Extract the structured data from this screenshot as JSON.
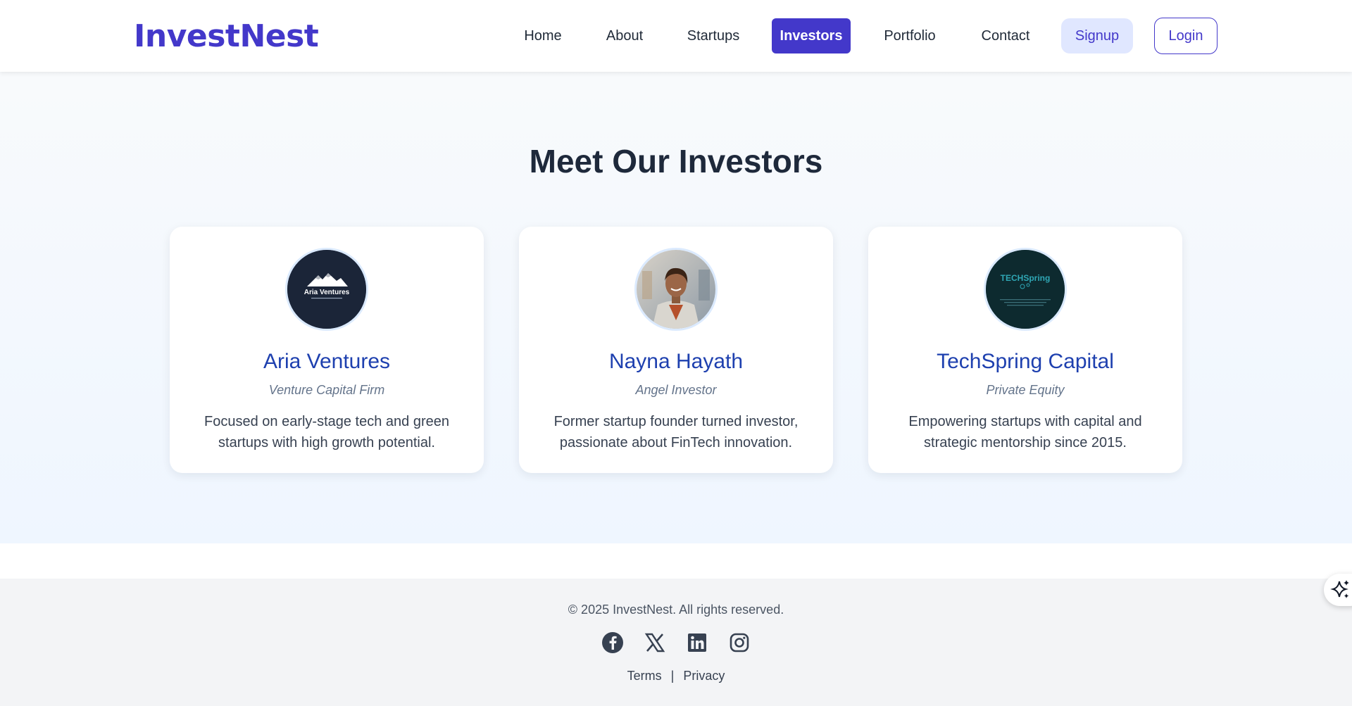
{
  "header": {
    "logo": "InvestNest",
    "nav": [
      "Home",
      "About",
      "Startups",
      "Investors",
      "Portfolio",
      "Contact"
    ],
    "active_nav": "Investors",
    "signup": "Signup",
    "login": "Login"
  },
  "main": {
    "title": "Meet Our Investors",
    "investors": [
      {
        "name": "Aria Ventures",
        "role": "Venture Capital Firm",
        "description": "Focused on early-stage tech and green startups with high growth potential.",
        "logo_text": "Aria Ventures"
      },
      {
        "name": "Nayna Hayath",
        "role": "Angel Investor",
        "description": "Former startup founder turned investor, passionate about FinTech innovation."
      },
      {
        "name": "TechSpring Capital",
        "role": "Private Equity",
        "description": "Empowering startups with capital and strategic mentorship since 2015.",
        "logo_text": "TECHSpring"
      }
    ]
  },
  "footer": {
    "copyright": "© 2025 InvestNest. All rights reserved.",
    "socials": [
      "facebook-icon",
      "x-icon",
      "linkedin-icon",
      "instagram-icon"
    ],
    "terms": "Terms",
    "separator": "|",
    "privacy": "Privacy"
  },
  "colors": {
    "brand": "#4338ca",
    "name": "#1e40af",
    "title": "#1e293b"
  }
}
